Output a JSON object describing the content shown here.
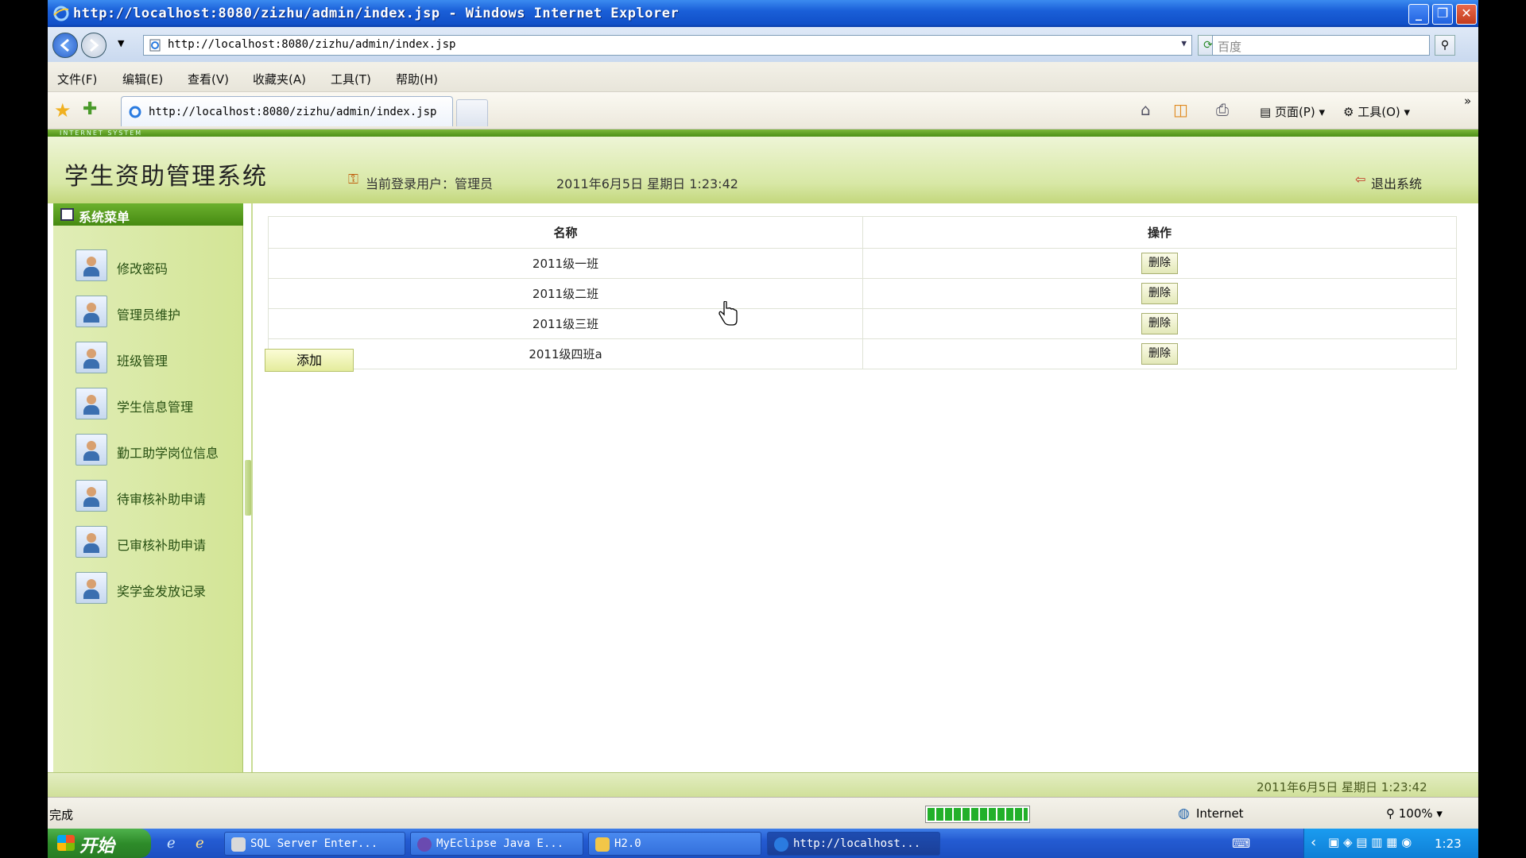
{
  "window": {
    "title": "http://localhost:8080/zizhu/admin/index.jsp - Windows Internet Explorer",
    "minimize": "_",
    "maximize": "❐",
    "close": "✕"
  },
  "browser": {
    "address": "http://localhost:8080/zizhu/admin/index.jsp",
    "search_placeholder": "百度",
    "menu": [
      "文件(F)",
      "编辑(E)",
      "查看(V)",
      "收藏夹(A)",
      "工具(T)",
      "帮助(H)"
    ],
    "tab_title": "http://localhost:8080/zizhu/admin/index.jsp",
    "commands": {
      "page": "页面(P)",
      "tools": "工具(O)"
    }
  },
  "app": {
    "strip_text": "INTERNET SYSTEM",
    "title": "学生资助管理系统",
    "user_info": "当前登录用户：管理员",
    "datetime": "2011年6月5日 星期日 1:23:42",
    "logout": "退出系统",
    "sidebar": {
      "header": "系统菜单",
      "items": [
        "修改密码",
        "管理员维护",
        "班级管理",
        "学生信息管理",
        "勤工助学岗位信息",
        "待审核补助申请",
        "已审核补助申请",
        "奖学金发放记录"
      ]
    },
    "table": {
      "headers": [
        "名称",
        "操作"
      ],
      "rows": [
        {
          "name": "2011级一班",
          "action": "删除"
        },
        {
          "name": "2011级二班",
          "action": "删除"
        },
        {
          "name": "2011级三班",
          "action": "删除"
        },
        {
          "name": "2011级四班a",
          "action": "删除"
        }
      ]
    },
    "add_button": "添加",
    "footer_date": "2011年6月5日 星期日 1:23:42"
  },
  "statusbar": {
    "status": "完成",
    "zone": "Internet",
    "zoom": "100%"
  },
  "taskbar": {
    "start": "开始",
    "tasks": [
      "SQL Server Enter...",
      "MyEclipse Java E...",
      "H2.0",
      "http://localhost..."
    ],
    "clock": "1:23"
  },
  "colors": {
    "accent_green": "#5fa020",
    "xp_blue": "#245bd2"
  }
}
